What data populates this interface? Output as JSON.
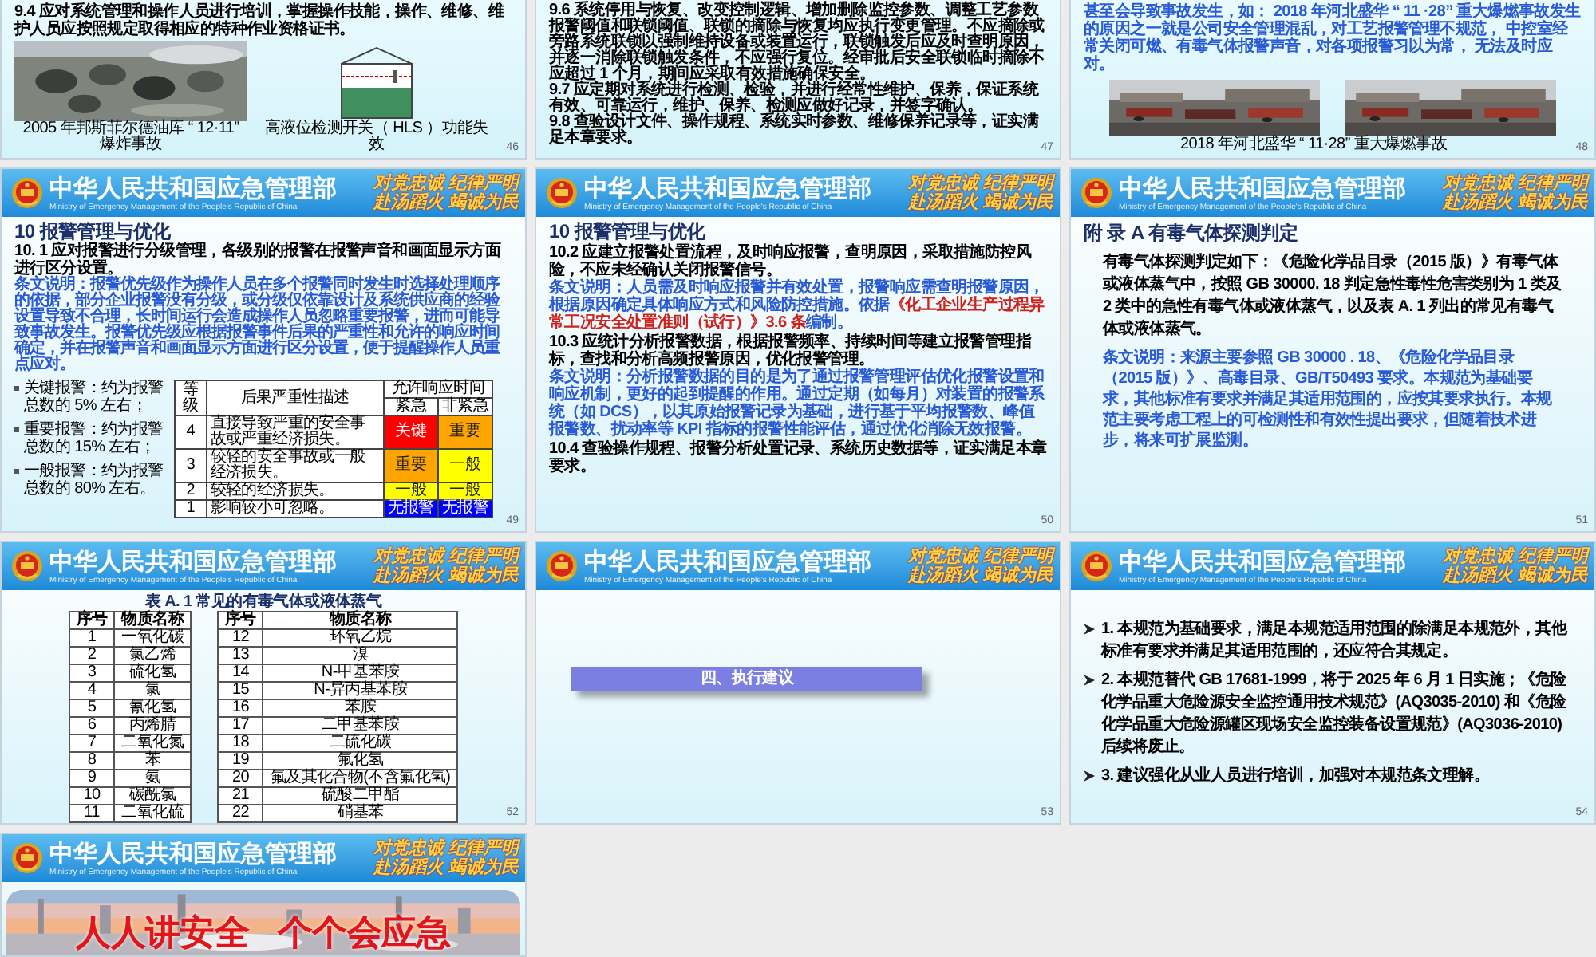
{
  "slides": [
    {
      "kind": "training",
      "page": "46",
      "clause": "9.4 应对系统管理和操作人员进行培训，掌握操作技能，操作、维修、维护人员应按照规定取得相应的特种作业资格证书。",
      "figures": [
        {
          "caption": "2005 年邦斯菲尔德油库 “ 12·11” 爆炸事故"
        },
        {
          "kind": "diagram",
          "caption": "高液位检测开关（ HLS ）功能失效"
        }
      ]
    },
    {
      "kind": "clauses",
      "page": "47",
      "clauses": [
        "9.6 系统停用与恢复、改变控制逻辑、增加删除监控参数、调整工艺参数报警阈值和联锁阈值、联锁的摘除与恢复均应执行变更管理。不应摘除或旁路系统联锁以强制维持设备或装置运行，联锁触发后应及时查明原因，并逐一消除联锁触发条件，不应强行复位。经审批后安全联锁临时摘除不应超过 1 个月，期间应采取有效措施确保安全。",
        "9.7 应定期对系统进行检测、检验，并进行经常性维护、保养，保证系统有效、可靠运行，维护、保养、检测应做好记录，并签字确认。",
        "9.8 查验设计文件、操作规程、系统实时参数、维修保养记录等，证实满足本章要求。"
      ]
    },
    {
      "kind": "accident",
      "page": "48",
      "text": "甚至会导致事故发生，如： 2018 年河北盛华 “ 11 ·28” 重大爆燃事故发生的原因之一就是公司安全管理混乱，对工艺报警管理不规范， 中控室经常关闭可燃、有毒气体报警声音，对各项报警习以为常， 无法及时应对。",
      "caption": "2018 年河北盛华 “ 11·28” 重大爆燃事故"
    },
    {
      "kind": "alarm_table",
      "page": "49",
      "header": {
        "title": "中华人民共和国应急管理部",
        "subtitle": "Ministry of Emergency Management of the People's Republic of China",
        "slogans": [
          "对党忠诚 纪律严明",
          "赴汤蹈火 竭诚为民"
        ]
      },
      "title": "10 报警管理与优化",
      "clause": "10. 1 应对报警进行分级管理，各级别的报警在报警声音和画面显示方面进行区分设置。",
      "note": "条文说明：报警优先级作为操作人员在多个报警同时发生时选择处理顺序的依据，部分企业报警没有分级，或分级仅依靠设计及系统供应商的经验设置导致不合理，长时间运行会造成操作人员忽略重要报警，进而可能导致事故发生。报警优先级应根据报警事件后果的严重性和允许的响应时间确定，并在报警声音和画面显示方面进行区分设置，便于提醒操作人员重点应对。",
      "bullets": [
        "关键报警：约为报警总数的 5% 左右；",
        "重要报警：约为报警总数的 15% 左右；",
        "一般报警：约为报警总数的 80% 左右。"
      ],
      "table": {
        "columns": [
          "等级",
          "后果严重性描述",
          "允许响应时间"
        ],
        "subcolumns": [
          "紧急",
          "非紧急"
        ],
        "rows": [
          {
            "level": "4",
            "description": "直接导致严重的安全事故或严重经济损失。",
            "urgent": {
              "text": "关键",
              "color": "#ff0000"
            },
            "non_urgent": {
              "text": "重要",
              "color": "#ffa500"
            }
          },
          {
            "level": "3",
            "description": "较轻的安全事故或一般经济损失。",
            "urgent": {
              "text": "重要",
              "color": "#ffa500"
            },
            "non_urgent": {
              "text": "一般",
              "color": "#ffff00"
            }
          },
          {
            "level": "2",
            "description": "较轻的经济损失。",
            "urgent": {
              "text": "一般",
              "color": "#ffff00"
            },
            "non_urgent": {
              "text": "一般",
              "color": "#ffff00"
            }
          },
          {
            "level": "1",
            "description": "影响较小可忽略。",
            "urgent": {
              "text": "无报警",
              "color": "#0000ff"
            },
            "non_urgent": {
              "text": "无报警",
              "color": "#0000ff"
            }
          }
        ]
      }
    },
    {
      "kind": "alarm_notes",
      "page": "50",
      "header": {
        "title": "中华人民共和国应急管理部",
        "subtitle": "Ministry of Emergency Management of the People's Republic of China",
        "slogans": [
          "对党忠诚 纪律严明",
          "赴汤蹈火 竭诚为民"
        ]
      },
      "title": "10 报警管理与优化",
      "blocks": [
        {
          "clause": "10.2 应建立报警处置流程，及时响应报警，查明原因，采取措施防控风险，不应未经确认关闭报警信号。",
          "note": [
            {
              "text": "条文说明：人员需及时响应报警并有效处置，报警响应需查明报警原因，根据原因确定具体响应方式和风险防控措施。依据",
              "emphasis": false
            },
            {
              "text": "《化工企业生产过程异常工况安全处置准则（试行）》3.6 条",
              "emphasis": true
            },
            {
              "text": "编制。",
              "emphasis": false
            }
          ]
        },
        {
          "clause": "10.3 应统计分析报警数据，根据报警频率、持续时间等建立报警管理指标，查找和分析高频报警原因，优化报警管理。",
          "note": [
            {
              "text": "条文说明：分析报警数据的目的是为了通过报警管理评估优化报警设置和响应机制，更好的起到提醒的作用。通过定期（如每月）对装置的报警系统（如 DCS），以其原始报警记录为基础，进行基于平均报警数、峰值报警数、扰动率等 KPI 指标的报警性能评估，通过优化消除无效报警。",
              "emphasis": false
            }
          ]
        },
        {
          "clause": "10.4 查验操作规程、报警分析处置记录、系统历史数据等，证实满足本章要求。"
        }
      ]
    },
    {
      "kind": "appendix",
      "page": "51",
      "header": {
        "title": "中华人民共和国应急管理部",
        "subtitle": "Ministry of Emergency Management of the People's Republic of China",
        "slogans": [
          "对党忠诚 纪律严明",
          "赴汤蹈火 竭诚为民"
        ]
      },
      "title": "附 录 A 有毒气体探测判定",
      "clause": "有毒气体探测判定如下：《危险化学品目录（2015 版）》有毒气体或液体蒸气中，按照 GB 30000. 18 判定急性毒性危害类别为 1 类及 2 类中的急性有毒气体或液体蒸气，以及表 A. 1 列出的常见有毒气体或液体蒸气。",
      "note": "条文说明：来源主要参照 GB 30000 . 18、《危险化学品目录（2015 版）》、高毒目录、GB/T50493 要求。本规范为基础要求，其他标准有要求并满足其适用范围的，应按其要求执行。本规范主要考虑工程上的可检测性和有效性提出要求，但随着技术进步，将来可扩展监测。"
    },
    {
      "kind": "substance_table",
      "page": "52",
      "header": {
        "title": "中华人民共和国应急管理部",
        "subtitle": "Ministry of Emergency Management of the People's Republic of China",
        "slogans": [
          "对党忠诚 纪律严明",
          "赴汤蹈火 竭诚为民"
        ]
      },
      "caption": "表 A. 1 常见的有毒气体或液体蒸气",
      "tables": [
        {
          "columns": [
            "序号",
            "物质名称"
          ],
          "rows": [
            [
              "1",
              "一氧化碳"
            ],
            [
              "2",
              "氯乙烯"
            ],
            [
              "3",
              "硫化氢"
            ],
            [
              "4",
              "氯"
            ],
            [
              "5",
              "氰化氢"
            ],
            [
              "6",
              "丙烯腈"
            ],
            [
              "7",
              "二氧化氮"
            ],
            [
              "8",
              "苯"
            ],
            [
              "9",
              "氨"
            ],
            [
              "10",
              "碳酰氯"
            ],
            [
              "11",
              "二氧化硫"
            ]
          ]
        },
        {
          "columns": [
            "序号",
            "物质名称"
          ],
          "rows": [
            [
              "12",
              "环氧乙烷"
            ],
            [
              "13",
              "溴"
            ],
            [
              "14",
              "N-甲基苯胺"
            ],
            [
              "15",
              "N-异丙基苯胺"
            ],
            [
              "16",
              "苯胺"
            ],
            [
              "17",
              "二甲基苯胺"
            ],
            [
              "18",
              "二硫化碳"
            ],
            [
              "19",
              "氟化氢"
            ],
            [
              "20",
              "氟及其化合物(不含氟化氢)"
            ],
            [
              "21",
              "硫酸二甲酯"
            ],
            [
              "22",
              "硝基苯"
            ]
          ]
        }
      ]
    },
    {
      "kind": "section",
      "page": "53",
      "header": {
        "title": "中华人民共和国应急管理部",
        "subtitle": "Ministry of Emergency Management of the People's Republic of China",
        "slogans": [
          "对党忠诚 纪律严明",
          "赴汤蹈火 竭诚为民"
        ]
      },
      "title": "四、执行建议"
    },
    {
      "kind": "bullets",
      "page": "54",
      "header": {
        "title": "中华人民共和国应急管理部",
        "subtitle": "Ministry of Emergency Management of the People's Republic of China",
        "slogans": [
          "对党忠诚 纪律严明",
          "赴汤蹈火 竭诚为民"
        ]
      },
      "items": [
        "1. 本规范为基础要求，满足本规范适用范围的除满足本规范外，其他标准有要求并满足其适用范围的，还应符合其规定。",
        "2. 本规范替代 GB 17681-1999，将于 2025 年 6 月 1 日实施；《危险化学品重大危险源安全监控通用技术规范》(AQ3035-2010) 和《危险化学品重大危险源罐区现场安全监控装备设置规范》(AQ3036-2010) 后续将废止。",
        "3. 建议强化从业人员进行培训，加强对本规范条文理解。"
      ]
    },
    {
      "kind": "cover",
      "header": {
        "title": "中华人民共和国应急管理部",
        "subtitle": "Ministry of Emergency Management of the People's Republic of China",
        "slogans": [
          "对党忠诚 纪律严明",
          "赴汤蹈火 竭诚为民"
        ]
      },
      "slogan": "人人讲安全 个个会应急"
    }
  ]
}
